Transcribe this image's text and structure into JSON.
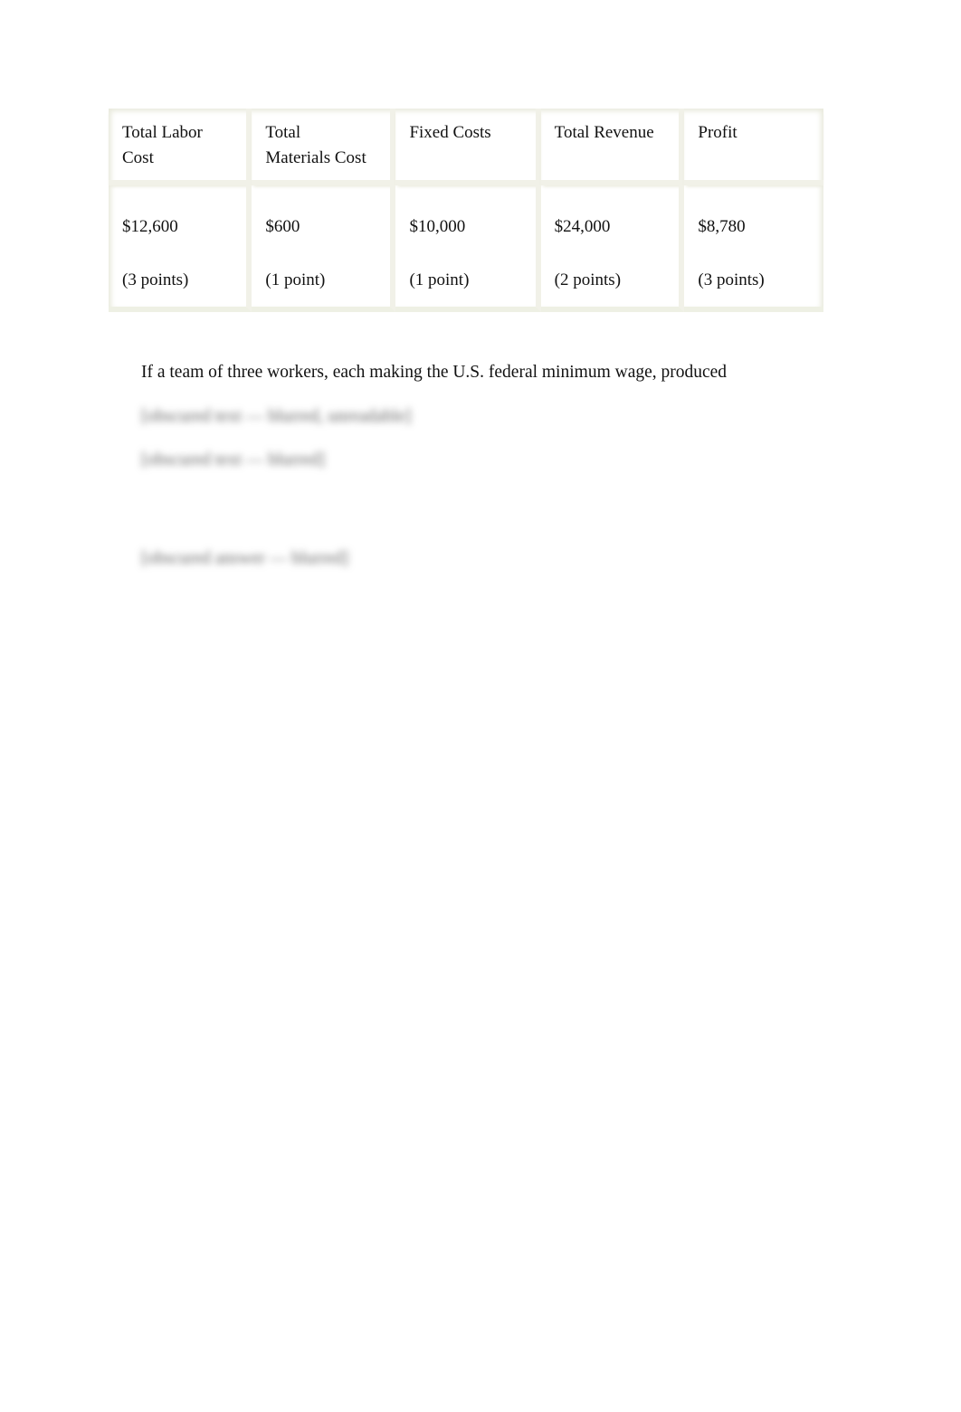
{
  "table": {
    "headers": [
      "Total Labor Cost",
      "Total Materials Cost",
      "Fixed Costs",
      "Total Revenue",
      "Profit"
    ],
    "header_lines": [
      [
        "Total Labor",
        "Cost"
      ],
      [
        "Total",
        "Materials Cost"
      ],
      [
        "Fixed Costs",
        ""
      ],
      [
        "Total Revenue",
        ""
      ],
      [
        "Profit",
        ""
      ]
    ],
    "values": [
      "$12,600",
      "$600",
      "$10,000",
      "$24,000",
      "$8,780"
    ],
    "points": [
      "(3 points)",
      "(1 point)",
      "(1 point)",
      "(2 points)",
      "(3 points)"
    ]
  },
  "question": {
    "visible_text": "If a team of three workers, each making the U.S. federal minimum wage, produced",
    "blurred_line_1": "[obscured text — blurred, unreadable]",
    "blurred_line_2": "[obscured text — blurred]",
    "blurred_answer": "[obscured answer — blurred]"
  }
}
